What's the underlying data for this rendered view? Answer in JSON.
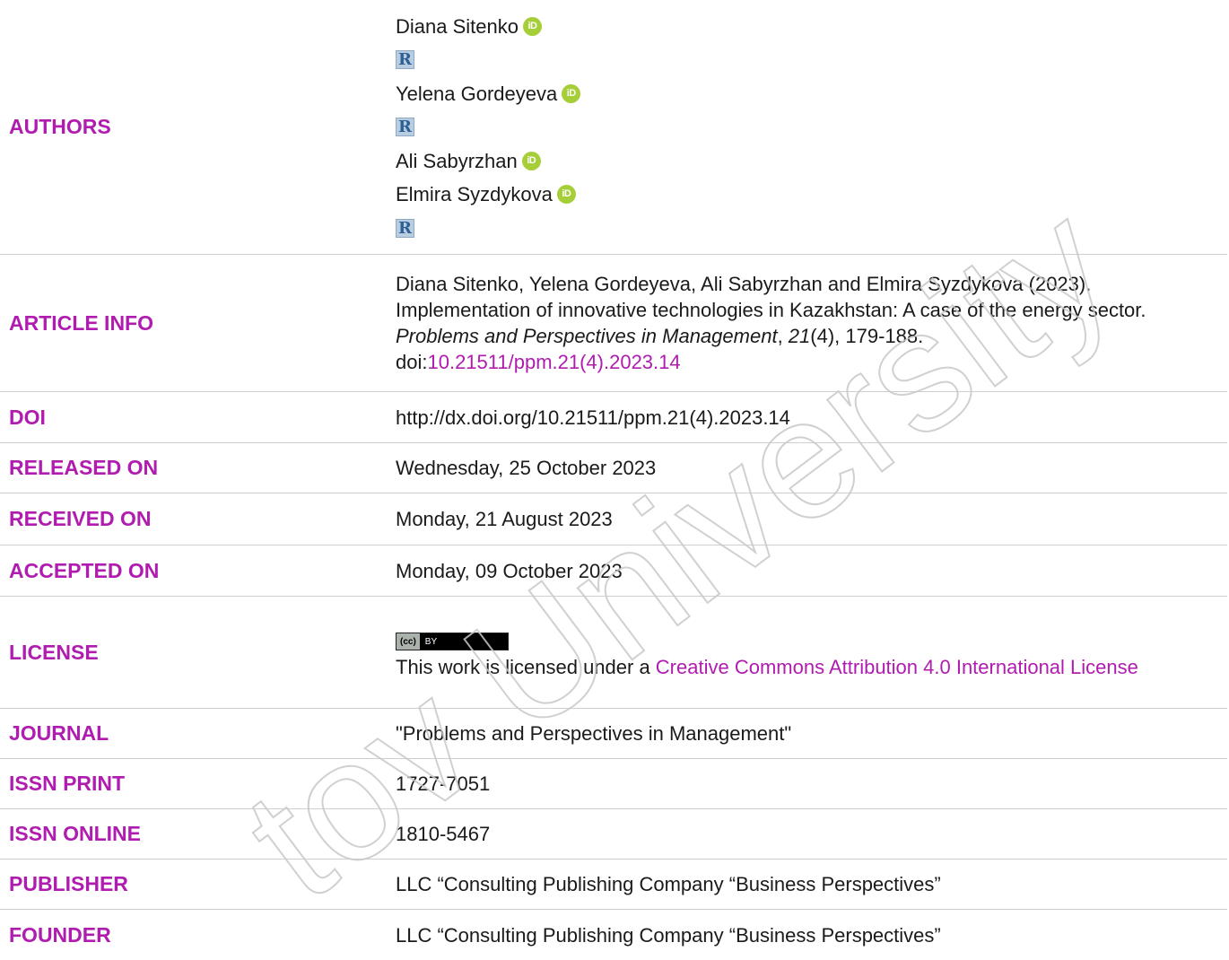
{
  "authors": {
    "label": "AUTHORS",
    "list": [
      {
        "name": "Diana Sitenko",
        "orcid": true,
        "rinc": true
      },
      {
        "name": "Yelena Gordeyeva",
        "orcid": true,
        "rinc": true
      },
      {
        "name": "Ali Sabyrzhan",
        "orcid": true,
        "rinc": false
      },
      {
        "name": "Elmira Syzdykova",
        "orcid": true,
        "rinc": true
      }
    ],
    "orcid_glyph": "iD",
    "rinc_glyph": "R"
  },
  "article_info": {
    "label": "ARTICLE INFO",
    "citation_pre": "Diana Sitenko, Yelena Gordeyeva, Ali Sabyrzhan and Elmira Syzdykova (2023). Implementation of innovative technologies in Kazakhstan: A case of the energy sector. ",
    "journal_italic": "Problems and Perspectives in Management",
    "comma1": ", ",
    "volume_italic": "21",
    "issue_pages": "(4), 179-188.",
    "doi_prefix": "doi:",
    "doi_link": "10.21511/ppm.21(4).2023.14"
  },
  "doi": {
    "label": "DOI",
    "value": "http://dx.doi.org/10.21511/ppm.21(4).2023.14"
  },
  "released": {
    "label": "RELEASED ON",
    "value": "Wednesday, 25 October 2023"
  },
  "received": {
    "label": "RECEIVED ON",
    "value": "Monday, 21 August 2023"
  },
  "accepted": {
    "label": "ACCEPTED ON",
    "value": "Monday, 09 October 2023"
  },
  "license": {
    "label": "LICENSE",
    "badge_cc": "(cc)",
    "badge_by": "BY",
    "text_pre": "This work is licensed under a ",
    "link_text": "Creative Commons Attribution 4.0 International License"
  },
  "journal": {
    "label": "JOURNAL",
    "value": "\"Problems and Perspectives in Management\""
  },
  "issn_print": {
    "label": "ISSN PRINT",
    "value": "1727-7051"
  },
  "issn_online": {
    "label": "ISSN ONLINE",
    "value": "1810-5467"
  },
  "publisher": {
    "label": "PUBLISHER",
    "value": "LLC “Consulting Publishing Company “Business Perspectives”"
  },
  "founder": {
    "label": "FOUNDER",
    "value": "LLC “Consulting Publishing Company “Business Perspectives”"
  },
  "watermark": {
    "text": "tov University",
    "color": "#c8c8c8"
  },
  "colors": {
    "accent": "#b01bb0",
    "orcid": "#a6ce39",
    "rinc": "#2f5f95"
  }
}
